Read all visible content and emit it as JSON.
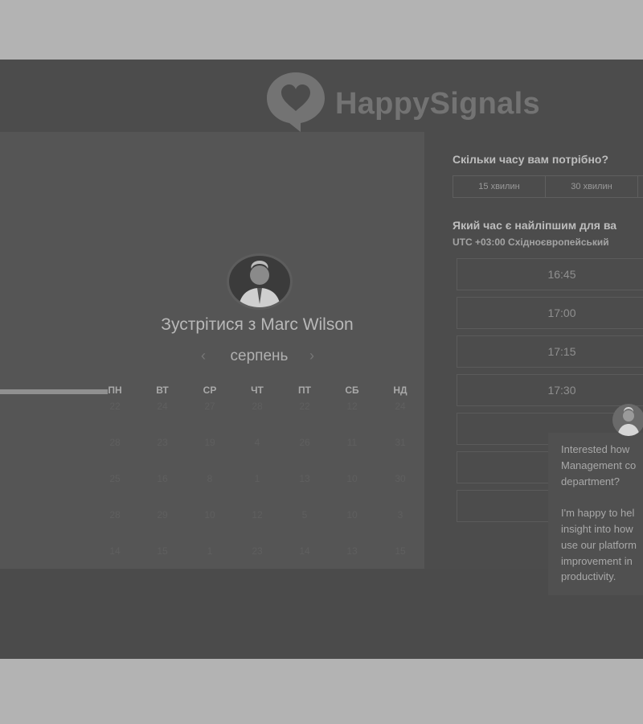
{
  "brand": {
    "name": "HappySignals"
  },
  "left": {
    "meet_title": "Зустрітися з Marc Wilson",
    "month": "серпень",
    "prev_arrow": "‹",
    "next_arrow": "›",
    "weekdays": [
      "ПН",
      "ВТ",
      "СР",
      "ЧТ",
      "ПТ",
      "СБ",
      "НД"
    ],
    "weeks": [
      [
        "22",
        "24",
        "27",
        "28",
        "22",
        "12",
        "24"
      ],
      [
        "28",
        "23",
        "19",
        "4",
        "26",
        "11",
        "31"
      ],
      [
        "25",
        "16",
        "8",
        "1",
        "13",
        "10",
        "30"
      ],
      [
        "28",
        "29",
        "10",
        "12",
        "5",
        "10",
        "3"
      ],
      [
        "14",
        "15",
        "1",
        "23",
        "14",
        "13",
        "15"
      ]
    ]
  },
  "right": {
    "duration_question": "Скільки часу вам потрібно?",
    "durations": [
      "15 хвилин",
      "30 хвилин"
    ],
    "time_question": "Який час є найліпшим для ва",
    "timezone": "UTC +03:00 Східноєвропейський",
    "slots": [
      "16:45",
      "17:00",
      "17:15",
      "17:30",
      "",
      "",
      ""
    ]
  },
  "chat": {
    "paragraph1": [
      "Interested how",
      "Management co",
      "department?"
    ],
    "paragraph2": [
      "I'm happy to hel",
      "insight into how",
      "use our platform",
      "improvement in",
      "productivity."
    ]
  }
}
